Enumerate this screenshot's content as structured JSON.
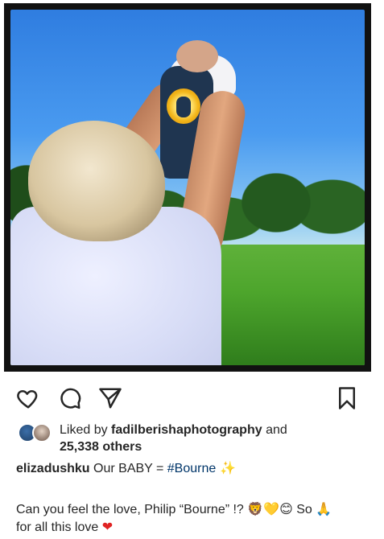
{
  "post": {
    "photo_alt": "Grandmother holding baby up to the sky in a green field"
  },
  "actions": {
    "like_icon": "heart-outline-icon",
    "comment_icon": "comment-bubble-icon",
    "share_icon": "paper-plane-icon",
    "save_icon": "bookmark-icon"
  },
  "likes": {
    "prefix": "Liked by ",
    "user": "fadilberishaphotography",
    "and": " and",
    "count": "25,338 others"
  },
  "caption": {
    "username": "elizadushku",
    "text_before": " Our BABY = ",
    "hashtag": "#Bourne",
    "emoji": " ✨"
  },
  "comment": {
    "line1_text": "Can you feel the love, Philip “Bourne” !? ",
    "line1_emoji": "🦁💛😊",
    "line1_so": " So ",
    "line1_pray": "🙏",
    "line2_text": "for all this love ",
    "line2_heart": "❤"
  },
  "colors": {
    "text": "#262626",
    "hashtag": "#003569",
    "heart": "#e02424"
  }
}
